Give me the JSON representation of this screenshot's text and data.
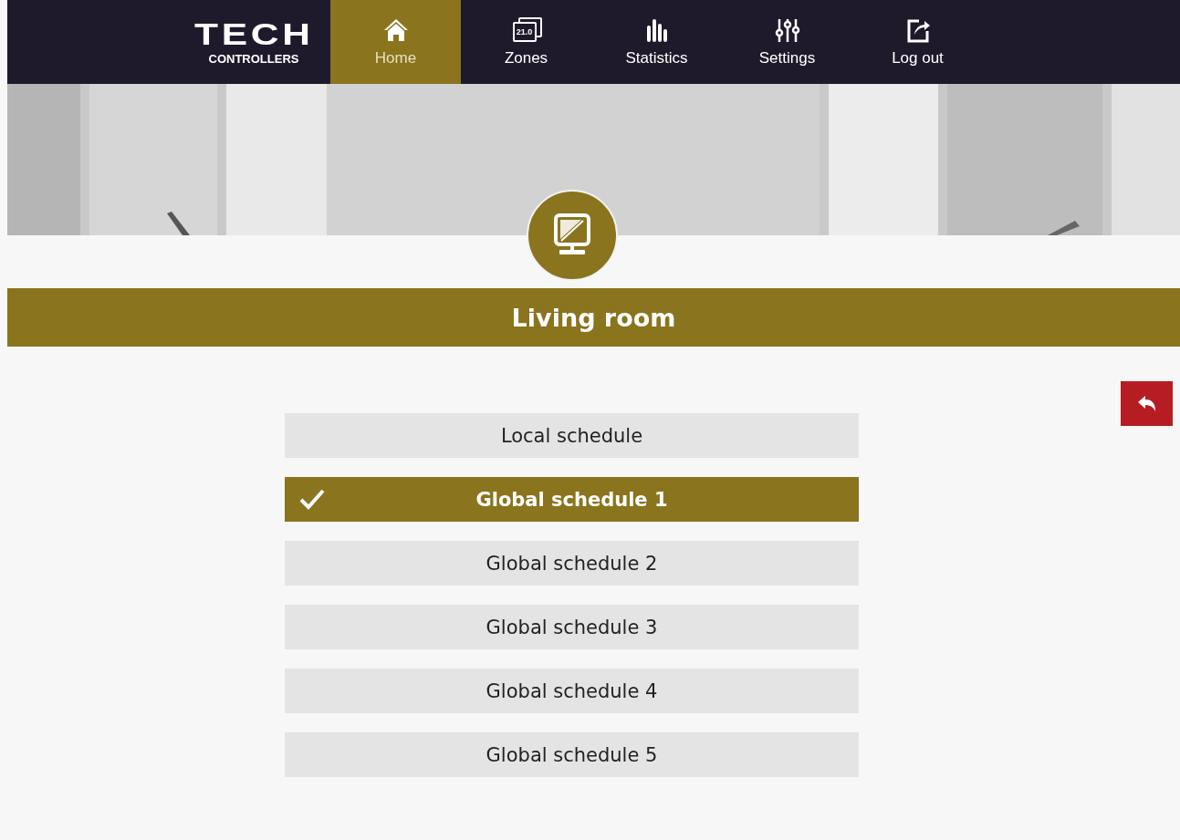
{
  "logo": {
    "brand": "TECH",
    "subtitle": "CONTROLLERS"
  },
  "nav": [
    {
      "kind": "home",
      "label": "Home",
      "selected": true
    },
    {
      "kind": "zones",
      "label": "Zones",
      "icon_text": "21.0",
      "selected": false
    },
    {
      "kind": "statistics",
      "label": "Statistics",
      "selected": false
    },
    {
      "kind": "settings",
      "label": "Settings",
      "selected": false
    },
    {
      "kind": "logout",
      "label": "Log out",
      "selected": false
    }
  ],
  "zone": {
    "title": "Living room"
  },
  "schedules": [
    {
      "label": "Local schedule",
      "selected": false
    },
    {
      "label": "Global schedule 1",
      "selected": true
    },
    {
      "label": "Global schedule 2",
      "selected": false
    },
    {
      "label": "Global schedule 3",
      "selected": false
    },
    {
      "label": "Global schedule 4",
      "selected": false
    },
    {
      "label": "Global schedule 5",
      "selected": false
    }
  ]
}
